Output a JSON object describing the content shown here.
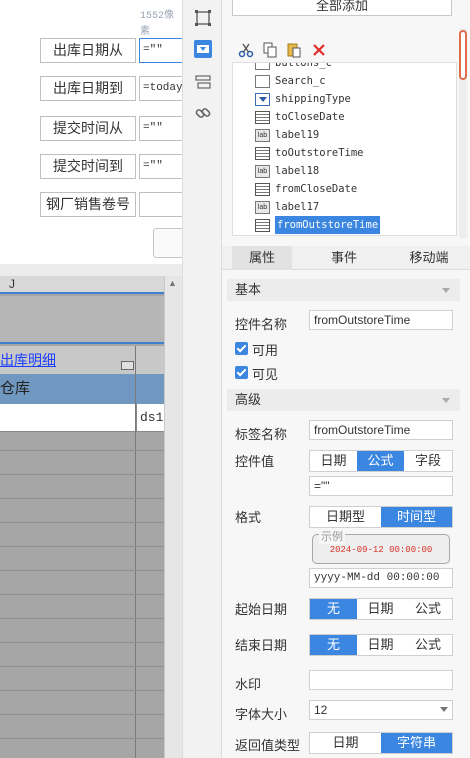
{
  "canvas": {
    "pixel_label": "1552像素",
    "fields": [
      {
        "label": "出库日期从",
        "value": "=\"\""
      },
      {
        "label": "出库日期到",
        "value": "=today("
      },
      {
        "label": "提交时间从",
        "value": "=\"\""
      },
      {
        "label": "提交时间到",
        "value": "=\"\""
      },
      {
        "label": "钢厂销售卷号",
        "value": ""
      }
    ]
  },
  "sheet": {
    "column_letter": "J",
    "link_text": "出库明细",
    "header_text": "仓库",
    "cell_text": "ds1."
  },
  "right": {
    "add_all_label": "全部添加",
    "tree_items": [
      {
        "name": "buttons_c",
        "icon": "button-icon"
      },
      {
        "name": "Search_c",
        "icon": "document-icon"
      },
      {
        "name": "shippingType",
        "icon": "dropdown-icon"
      },
      {
        "name": "toCloseDate",
        "icon": "calendar-icon"
      },
      {
        "name": "label19",
        "icon": "label-icon"
      },
      {
        "name": "toOutstoreTime",
        "icon": "calendar-icon"
      },
      {
        "name": "label18",
        "icon": "label-icon"
      },
      {
        "name": "fromCloseDate",
        "icon": "calendar-icon"
      },
      {
        "name": "label17",
        "icon": "label-icon"
      },
      {
        "name": "fromOutstoreTime",
        "icon": "calendar-icon",
        "selected": true
      }
    ],
    "tabs": [
      "属性",
      "事件",
      "移动端"
    ],
    "props": {
      "basic_title": "基本",
      "control_name_label": "控件名称",
      "control_name_value": "fromOutstoreTime",
      "enabled_label": "可用",
      "visible_label": "可见",
      "advanced_title": "高级",
      "tag_name_label": "标签名称",
      "tag_name_value": "fromOutstoreTime",
      "control_value_label": "控件值",
      "control_value_options": [
        "日期",
        "公式",
        "字段"
      ],
      "formula_value": "=\"\"",
      "format_label": "格式",
      "format_options": [
        "日期型",
        "时间型"
      ],
      "example_legend": "示例",
      "example_value": "2024-09-12 00:00:00",
      "format_pattern": "yyyy-MM-dd 00:00:00",
      "start_date_label": "起始日期",
      "start_date_options": [
        "无",
        "日期",
        "公式"
      ],
      "end_date_label": "结束日期",
      "end_date_options": [
        "无",
        "日期",
        "公式"
      ],
      "watermark_label": "水印",
      "watermark_value": "",
      "font_size_label": "字体大小",
      "font_size_value": "12",
      "return_type_label": "返回值类型",
      "return_type_options": [
        "日期",
        "字符串"
      ]
    }
  },
  "colors": {
    "accent": "#3b86e0",
    "link": "#1e40ff",
    "example_red": "#d9332a"
  }
}
